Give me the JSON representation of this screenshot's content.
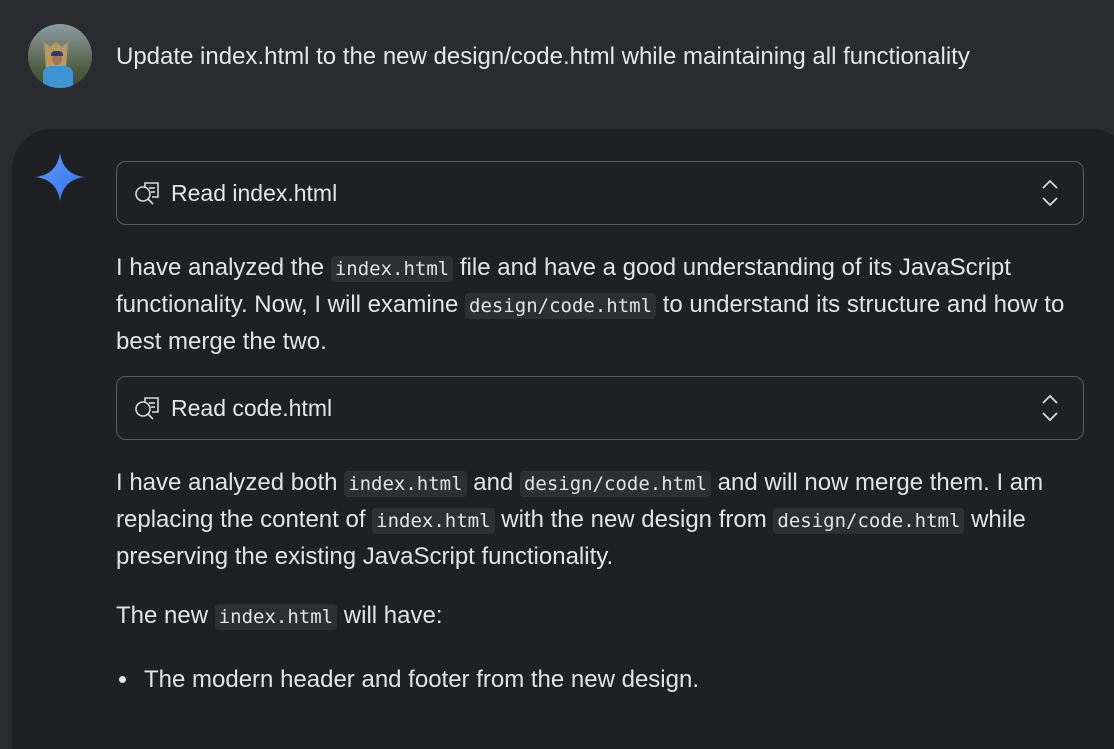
{
  "user_prompt": "Update index.html to the new design/code.html while maintaining all functionality",
  "tool_calls": [
    {
      "label": "Read index.html",
      "icon": "search-document-icon"
    },
    {
      "label": "Read code.html",
      "icon": "search-document-icon"
    }
  ],
  "messages": {
    "m1": {
      "t1": "I have analyzed the ",
      "c1": "index.html",
      "t2": " file and have a good understanding of its JavaScript functionality. Now, I will examine ",
      "c2": "design/code.html",
      "t3": " to understand its structure and how to best merge the two."
    },
    "m2": {
      "t1": "I have analyzed both ",
      "c1": "index.html",
      "t2": " and ",
      "c2": "design/code.html",
      "t3": " and will now merge them. I am replacing the content of ",
      "c3": "index.html",
      "t4": " with the new design from ",
      "c4": "design/code.html",
      "t5": " while preserving the existing JavaScript functionality."
    },
    "m3": {
      "t1": "The new ",
      "c1": "index.html",
      "t2": " will have:"
    },
    "bullets": [
      "The modern header and footer from the new design."
    ]
  },
  "colors": {
    "accent": "#4a86f7",
    "panel": "#1f2023",
    "background": "#2a2b2f"
  }
}
